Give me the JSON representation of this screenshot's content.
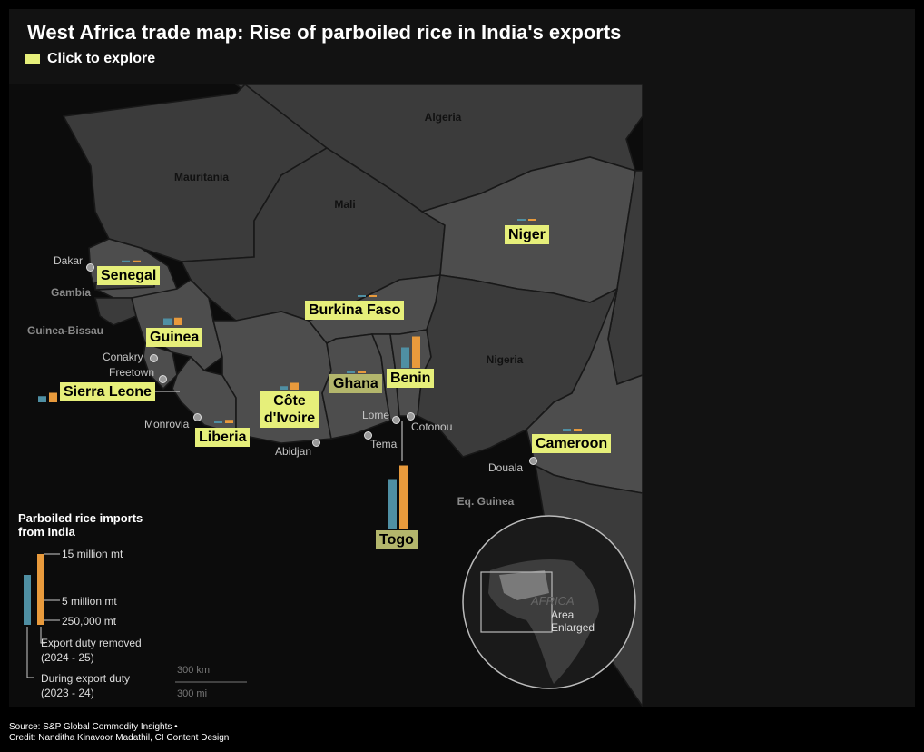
{
  "header": {
    "title": "West Africa trade map: Rise of parboiled rice in India's exports",
    "explore_label": "Click to explore"
  },
  "colors": {
    "highlight": "#e6ef7a",
    "bar_during_duty": "#4f8fa3",
    "bar_duty_removed": "#e89a3c"
  },
  "map_labels": {
    "algeria": "Algeria",
    "mauritania": "Mauritania",
    "mali": "Mali",
    "gambia": "Gambia",
    "guinea_bissau": "Guinea-Bissau",
    "nigeria": "Nigeria",
    "eq_guinea": "Eq. Guinea"
  },
  "countries": [
    {
      "key": "senegal",
      "name": "Senegal",
      "during_duty": 0.3,
      "duty_removed": 0.3
    },
    {
      "key": "guinea",
      "name": "Guinea",
      "during_duty": 1.0,
      "duty_removed": 1.1
    },
    {
      "key": "sierra_leone",
      "name": "Sierra Leone",
      "during_duty": 0.9,
      "duty_removed": 1.4
    },
    {
      "key": "liberia",
      "name": "Liberia",
      "during_duty": 0.3,
      "duty_removed": 0.5
    },
    {
      "key": "cote_divoire",
      "name": "Côte d'Ivoire",
      "during_duty": 0.5,
      "duty_removed": 1.0
    },
    {
      "key": "ghana",
      "name": "Ghana",
      "during_duty": 0.2,
      "duty_removed": 0.2
    },
    {
      "key": "burkina_faso",
      "name": "Burkina Faso",
      "during_duty": 0.1,
      "duty_removed": 0.1
    },
    {
      "key": "benin",
      "name": "Benin",
      "during_duty": 3.0,
      "duty_removed": 4.6
    },
    {
      "key": "togo",
      "name": "Togo",
      "during_duty": 7.4,
      "duty_removed": 9.4
    },
    {
      "key": "niger",
      "name": "Niger",
      "during_duty": 0.1,
      "duty_removed": 0.1
    },
    {
      "key": "cameroon",
      "name": "Cameroon",
      "during_duty": 0.4,
      "duty_removed": 0.4
    }
  ],
  "cities": {
    "dakar": "Dakar",
    "conakry": "Conakry",
    "freetown": "Freetown",
    "monrovia": "Monrovia",
    "abidjan": "Abidjan",
    "lome": "Lome",
    "tema": "Tema",
    "cotonou": "Cotonou",
    "douala": "Douala"
  },
  "legend": {
    "title_line1": "Parboiled rice imports",
    "title_line2": "from India",
    "tick_high": "15 million mt",
    "tick_mid": "5 million mt",
    "tick_low": "250,000 mt",
    "duty_removed_line1": "Export duty removed",
    "duty_removed_line2": "(2024 - 25)",
    "during_duty_line1": "During export duty",
    "during_duty_line2": "(2023 - 24)"
  },
  "scale": {
    "km": "300 km",
    "mi": "300 mi"
  },
  "inset": {
    "label_africa": "AFRICA",
    "area_line1": "Area",
    "area_line2": "Enlarged"
  },
  "footer": {
    "source": "Source: S&P Global Commodity Insights •",
    "credit": "Credit: Nanditha Kinavoor Madathil, CI Content Design"
  }
}
